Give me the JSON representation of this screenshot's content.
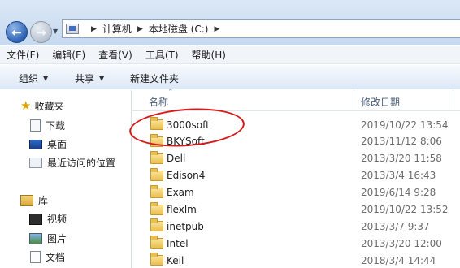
{
  "address_bar": {
    "breadcrumbs": [
      "计算机",
      "本地磁盘 (C:)"
    ]
  },
  "menu": [
    "文件(F)",
    "编辑(E)",
    "查看(V)",
    "工具(T)",
    "帮助(H)"
  ],
  "toolbar": {
    "organize": "组织",
    "share": "共享",
    "new_folder": "新建文件夹"
  },
  "nav": {
    "favorites": "收藏夹",
    "downloads": "下载",
    "desktop": "桌面",
    "recent": "最近访问的位置",
    "libraries": "库",
    "videos": "视频",
    "pictures": "图片",
    "documents": "文档"
  },
  "columns": {
    "name": "名称",
    "date_modified": "修改日期"
  },
  "files": [
    {
      "name": "3000soft",
      "date": "2019/10/22 13:54"
    },
    {
      "name": "BKYSoft",
      "date": "2013/11/12 8:06"
    },
    {
      "name": "Dell",
      "date": "2013/3/20 11:58"
    },
    {
      "name": "Edison4",
      "date": "2013/3/4 16:43"
    },
    {
      "name": "Exam",
      "date": "2019/6/14 9:28"
    },
    {
      "name": "flexlm",
      "date": "2019/10/22 13:52"
    },
    {
      "name": "inetpub",
      "date": "2013/3/7 9:37"
    },
    {
      "name": "Intel",
      "date": "2013/3/20 12:00"
    },
    {
      "name": "Keil",
      "date": "2018/3/4 14:44"
    }
  ],
  "annotation_color": "#d51a1a"
}
